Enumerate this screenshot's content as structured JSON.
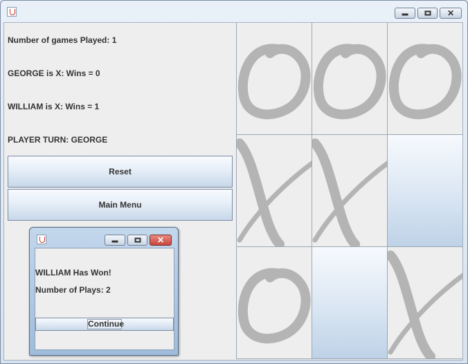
{
  "main_window": {
    "icon": "java-icon",
    "controls": {
      "minimize": "minimize-icon",
      "maximize": "maximize-icon",
      "close": "close-icon"
    }
  },
  "stats": {
    "games_played": "Number of games Played: 1",
    "player1": "GEORGE is X: Wins = 0",
    "player2": "WILLIAM is X: Wins = 1",
    "turn": "PLAYER TURN: GEORGE"
  },
  "buttons": {
    "reset": "Reset",
    "main_menu": "Main Menu"
  },
  "board": {
    "cells": [
      "O",
      "O",
      "O",
      "X",
      "X",
      "",
      "O",
      "",
      "X"
    ],
    "mark_color": "#b4b4b4"
  },
  "dialog": {
    "icon": "java-icon",
    "message": "WILLIAM Has Won!",
    "plays": "Number of Plays: 2",
    "continue": "Continue",
    "close_color": "#c9463d"
  }
}
